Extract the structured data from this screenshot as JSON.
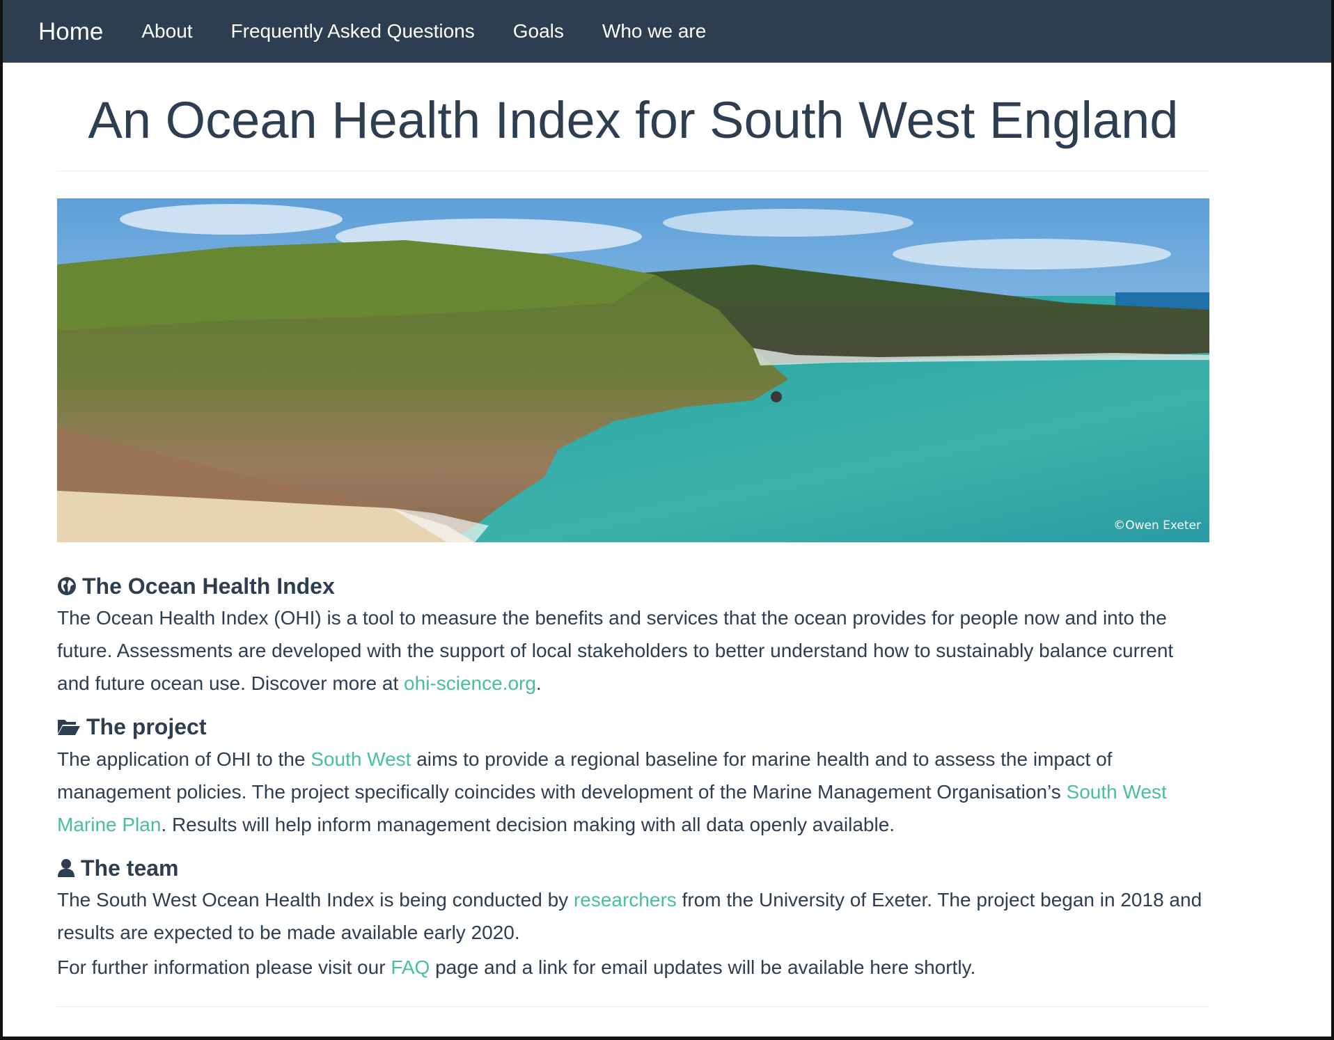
{
  "nav": {
    "brand": "Home",
    "items": [
      "About",
      "Frequently Asked Questions",
      "Goals",
      "Who we are"
    ]
  },
  "page": {
    "title": "An Ocean Health Index for South West England"
  },
  "hero": {
    "alt": "Coastal cliffs and turquoise sea in South West England",
    "credit": "©Owen Exeter"
  },
  "sections": {
    "ohi": {
      "heading": "The Ocean Health Index",
      "icon": "globe-icon",
      "p1": "The Ocean Health Index (OHI) is a tool to measure the benefits and services that the ocean provides for people now and into the future. Assessments are developed with the support of local stakeholders to better understand how to sustainably balance current and future ocean use. Discover more at ",
      "link": "ohi-science.org",
      "p2": "."
    },
    "project": {
      "heading": "The project",
      "icon": "folder-open-icon",
      "p1": "The application of OHI to the ",
      "link1": "South West",
      "p2": " aims to provide a regional baseline for marine health and to assess the impact of management policies. The project specifically coincides with development of the Marine Management Organisation’s ",
      "link2": "South West Marine Plan",
      "p3": ". Results will help inform management decision making with all data openly available."
    },
    "team": {
      "heading": "The team",
      "icon": "user-icon",
      "p1": "The South West Ocean Health Index is being conducted by ",
      "link": "researchers",
      "p2": " from the University of Exeter. The project began in 2018 and results are expected to be made available early 2020."
    },
    "further": {
      "p1": "For further information please visit our ",
      "link": "FAQ",
      "p2": " page and a link for email updates will be available here shortly."
    }
  },
  "colors": {
    "navbar": "#2c3e50",
    "text": "#2c3e50",
    "link": "#48bf9a"
  }
}
